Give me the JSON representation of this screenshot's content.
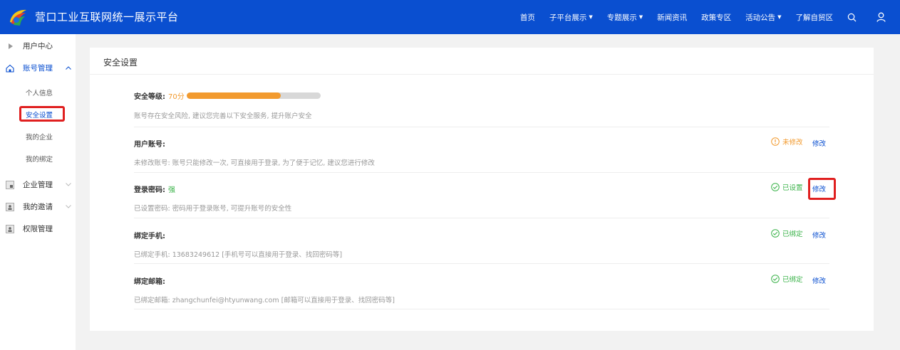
{
  "header": {
    "brand": "营口工业互联网统一展示平台",
    "nav": [
      {
        "label": "首页",
        "dropdown": false
      },
      {
        "label": "子平台展示",
        "dropdown": true
      },
      {
        "label": "专题展示",
        "dropdown": true
      },
      {
        "label": "新闻资讯",
        "dropdown": false
      },
      {
        "label": "政策专区",
        "dropdown": false
      },
      {
        "label": "活动公告",
        "dropdown": true
      },
      {
        "label": "了解自贸区",
        "dropdown": false
      }
    ],
    "icons": [
      "search-icon",
      "user-icon"
    ],
    "colors": {
      "bar": "#0a4fd0"
    }
  },
  "sidebar": {
    "groups": [
      {
        "label": "用户中心",
        "icon": "caret-right-icon"
      },
      {
        "label": "账号管理",
        "icon": "home-icon",
        "expanded": true
      },
      {
        "label": "企业管理",
        "icon": "enterprise-icon"
      },
      {
        "label": "我的邀请",
        "icon": "invite-icon"
      },
      {
        "label": "权限管理",
        "icon": "permission-icon"
      }
    ],
    "sub_items": [
      {
        "label": "个人信息"
      },
      {
        "label": "安全设置",
        "active": true
      },
      {
        "label": "我的企业"
      },
      {
        "label": "我的绑定"
      }
    ]
  },
  "main": {
    "title": "安全设置",
    "level": {
      "label": "安全等级:",
      "score_text": "70分",
      "progress_fraction": 0.7,
      "desc": "账号存在安全风险, 建议您完善以下安全服务, 提升账户安全"
    },
    "rows": [
      {
        "title": "用户账号:",
        "strength": "",
        "desc": "未修改账号: 账号只能修改一次, 可直接用于登录, 为了便于记忆, 建议您进行修改",
        "status": "未修改",
        "status_type": "warn",
        "action": "修改"
      },
      {
        "title": "登录密码:",
        "strength": "强",
        "desc": "已设置密码: 密码用于登录账号, 可提升账号的安全性",
        "status": "已设置",
        "status_type": "ok",
        "action": "修改"
      },
      {
        "title": "绑定手机:",
        "strength": "",
        "desc": "已绑定手机: 13683249612 [手机号可以直接用于登录、找回密码等]",
        "status": "已绑定",
        "status_type": "ok",
        "action": "修改"
      },
      {
        "title": "绑定邮箱:",
        "strength": "",
        "desc": "已绑定邮箱: zhangchunfei@htyunwang.com [邮箱可以直接用于登录、找回密码等]",
        "status": "已绑定",
        "status_type": "ok",
        "action": "修改"
      }
    ],
    "colors": {
      "accent": "#0a4fd0",
      "warn": "#f29a2e",
      "ok": "#3bb34a",
      "highlight": "#e02020"
    }
  }
}
